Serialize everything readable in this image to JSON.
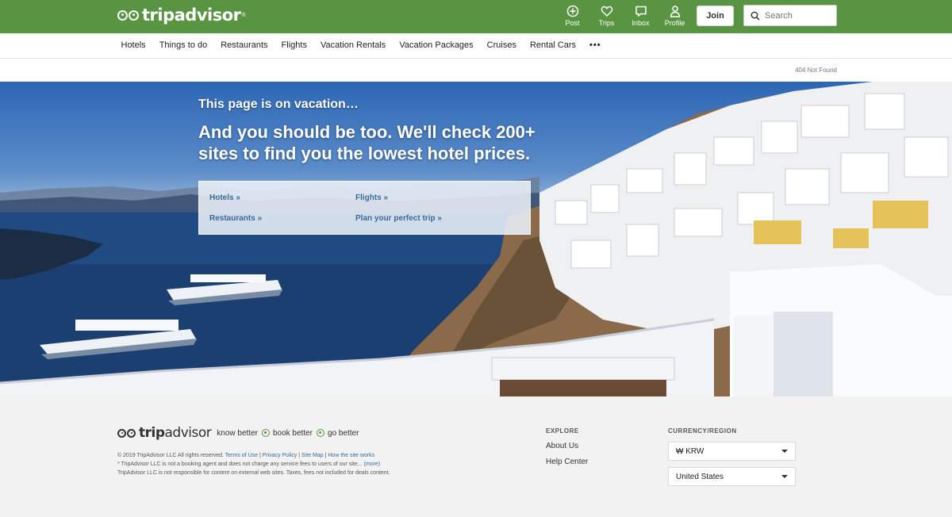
{
  "header": {
    "logo_text": "tripadvisor",
    "logo_reg": "®",
    "nav": [
      {
        "label": "Post",
        "icon": "post-icon"
      },
      {
        "label": "Trips",
        "icon": "heart-icon"
      },
      {
        "label": "Inbox",
        "icon": "inbox-icon"
      },
      {
        "label": "Profile",
        "icon": "profile-icon"
      }
    ],
    "join_label": "Join",
    "search_placeholder": "Search",
    "brand_color": "#589442"
  },
  "subnav": {
    "items": [
      "Hotels",
      "Things to do",
      "Restaurants",
      "Flights",
      "Vacation Rentals",
      "Vacation Packages",
      "Cruises",
      "Rental Cars"
    ],
    "more_label": "•••"
  },
  "breadcrumb": "404 Not Found",
  "hero": {
    "title": "This page is on vacation…",
    "subtitle": "And you should be too. We'll check 200+ sites to find you the lowest hotel prices.",
    "links": {
      "hotels": "Hotels »",
      "flights": "Flights »",
      "restaurants": "Restaurants »",
      "plan": "Plan your perfect trip »"
    }
  },
  "footer": {
    "logo_trip": "trip",
    "logo_advisor": "advisor",
    "tagline": [
      "know better",
      "book better",
      "go better"
    ],
    "legal": {
      "copyright": "© 2019 TripAdvisor LLC All rights reserved.",
      "links": [
        "Terms of Use",
        "Privacy Policy",
        "Site Map",
        "How the site works"
      ],
      "line2": "* TripAdvisor LLC is not a booking agent and does not charge any service fees to users of our site... ",
      "more": "(more)",
      "line3": "TripAdvisor LLC is not responsible for content on external web sites. Taxes, fees not included for deals content."
    },
    "explore": {
      "heading": "EXPLORE",
      "links": [
        "About Us",
        "Help Center"
      ]
    },
    "currency": {
      "heading": "CURRENCY/REGION",
      "currency_value": "₩  KRW",
      "region_value": "United States"
    }
  }
}
